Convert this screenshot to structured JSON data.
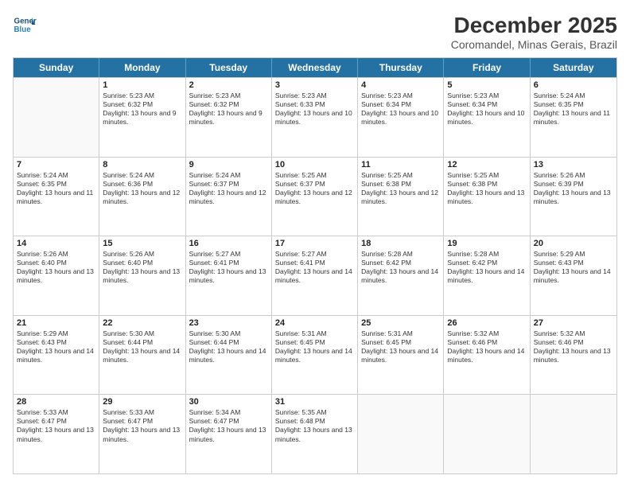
{
  "logo": {
    "line1": "General",
    "line2": "Blue"
  },
  "title": "December 2025",
  "subtitle": "Coromandel, Minas Gerais, Brazil",
  "header_days": [
    "Sunday",
    "Monday",
    "Tuesday",
    "Wednesday",
    "Thursday",
    "Friday",
    "Saturday"
  ],
  "weeks": [
    [
      {
        "day": "",
        "sunrise": "",
        "sunset": "",
        "daylight": ""
      },
      {
        "day": "1",
        "sunrise": "Sunrise: 5:23 AM",
        "sunset": "Sunset: 6:32 PM",
        "daylight": "Daylight: 13 hours and 9 minutes."
      },
      {
        "day": "2",
        "sunrise": "Sunrise: 5:23 AM",
        "sunset": "Sunset: 6:32 PM",
        "daylight": "Daylight: 13 hours and 9 minutes."
      },
      {
        "day": "3",
        "sunrise": "Sunrise: 5:23 AM",
        "sunset": "Sunset: 6:33 PM",
        "daylight": "Daylight: 13 hours and 10 minutes."
      },
      {
        "day": "4",
        "sunrise": "Sunrise: 5:23 AM",
        "sunset": "Sunset: 6:34 PM",
        "daylight": "Daylight: 13 hours and 10 minutes."
      },
      {
        "day": "5",
        "sunrise": "Sunrise: 5:23 AM",
        "sunset": "Sunset: 6:34 PM",
        "daylight": "Daylight: 13 hours and 10 minutes."
      },
      {
        "day": "6",
        "sunrise": "Sunrise: 5:24 AM",
        "sunset": "Sunset: 6:35 PM",
        "daylight": "Daylight: 13 hours and 11 minutes."
      }
    ],
    [
      {
        "day": "7",
        "sunrise": "Sunrise: 5:24 AM",
        "sunset": "Sunset: 6:35 PM",
        "daylight": "Daylight: 13 hours and 11 minutes."
      },
      {
        "day": "8",
        "sunrise": "Sunrise: 5:24 AM",
        "sunset": "Sunset: 6:36 PM",
        "daylight": "Daylight: 13 hours and 12 minutes."
      },
      {
        "day": "9",
        "sunrise": "Sunrise: 5:24 AM",
        "sunset": "Sunset: 6:37 PM",
        "daylight": "Daylight: 13 hours and 12 minutes."
      },
      {
        "day": "10",
        "sunrise": "Sunrise: 5:25 AM",
        "sunset": "Sunset: 6:37 PM",
        "daylight": "Daylight: 13 hours and 12 minutes."
      },
      {
        "day": "11",
        "sunrise": "Sunrise: 5:25 AM",
        "sunset": "Sunset: 6:38 PM",
        "daylight": "Daylight: 13 hours and 12 minutes."
      },
      {
        "day": "12",
        "sunrise": "Sunrise: 5:25 AM",
        "sunset": "Sunset: 6:38 PM",
        "daylight": "Daylight: 13 hours and 13 minutes."
      },
      {
        "day": "13",
        "sunrise": "Sunrise: 5:26 AM",
        "sunset": "Sunset: 6:39 PM",
        "daylight": "Daylight: 13 hours and 13 minutes."
      }
    ],
    [
      {
        "day": "14",
        "sunrise": "Sunrise: 5:26 AM",
        "sunset": "Sunset: 6:40 PM",
        "daylight": "Daylight: 13 hours and 13 minutes."
      },
      {
        "day": "15",
        "sunrise": "Sunrise: 5:26 AM",
        "sunset": "Sunset: 6:40 PM",
        "daylight": "Daylight: 13 hours and 13 minutes."
      },
      {
        "day": "16",
        "sunrise": "Sunrise: 5:27 AM",
        "sunset": "Sunset: 6:41 PM",
        "daylight": "Daylight: 13 hours and 13 minutes."
      },
      {
        "day": "17",
        "sunrise": "Sunrise: 5:27 AM",
        "sunset": "Sunset: 6:41 PM",
        "daylight": "Daylight: 13 hours and 14 minutes."
      },
      {
        "day": "18",
        "sunrise": "Sunrise: 5:28 AM",
        "sunset": "Sunset: 6:42 PM",
        "daylight": "Daylight: 13 hours and 14 minutes."
      },
      {
        "day": "19",
        "sunrise": "Sunrise: 5:28 AM",
        "sunset": "Sunset: 6:42 PM",
        "daylight": "Daylight: 13 hours and 14 minutes."
      },
      {
        "day": "20",
        "sunrise": "Sunrise: 5:29 AM",
        "sunset": "Sunset: 6:43 PM",
        "daylight": "Daylight: 13 hours and 14 minutes."
      }
    ],
    [
      {
        "day": "21",
        "sunrise": "Sunrise: 5:29 AM",
        "sunset": "Sunset: 6:43 PM",
        "daylight": "Daylight: 13 hours and 14 minutes."
      },
      {
        "day": "22",
        "sunrise": "Sunrise: 5:30 AM",
        "sunset": "Sunset: 6:44 PM",
        "daylight": "Daylight: 13 hours and 14 minutes."
      },
      {
        "day": "23",
        "sunrise": "Sunrise: 5:30 AM",
        "sunset": "Sunset: 6:44 PM",
        "daylight": "Daylight: 13 hours and 14 minutes."
      },
      {
        "day": "24",
        "sunrise": "Sunrise: 5:31 AM",
        "sunset": "Sunset: 6:45 PM",
        "daylight": "Daylight: 13 hours and 14 minutes."
      },
      {
        "day": "25",
        "sunrise": "Sunrise: 5:31 AM",
        "sunset": "Sunset: 6:45 PM",
        "daylight": "Daylight: 13 hours and 14 minutes."
      },
      {
        "day": "26",
        "sunrise": "Sunrise: 5:32 AM",
        "sunset": "Sunset: 6:46 PM",
        "daylight": "Daylight: 13 hours and 14 minutes."
      },
      {
        "day": "27",
        "sunrise": "Sunrise: 5:32 AM",
        "sunset": "Sunset: 6:46 PM",
        "daylight": "Daylight: 13 hours and 13 minutes."
      }
    ],
    [
      {
        "day": "28",
        "sunrise": "Sunrise: 5:33 AM",
        "sunset": "Sunset: 6:47 PM",
        "daylight": "Daylight: 13 hours and 13 minutes."
      },
      {
        "day": "29",
        "sunrise": "Sunrise: 5:33 AM",
        "sunset": "Sunset: 6:47 PM",
        "daylight": "Daylight: 13 hours and 13 minutes."
      },
      {
        "day": "30",
        "sunrise": "Sunrise: 5:34 AM",
        "sunset": "Sunset: 6:47 PM",
        "daylight": "Daylight: 13 hours and 13 minutes."
      },
      {
        "day": "31",
        "sunrise": "Sunrise: 5:35 AM",
        "sunset": "Sunset: 6:48 PM",
        "daylight": "Daylight: 13 hours and 13 minutes."
      },
      {
        "day": "",
        "sunrise": "",
        "sunset": "",
        "daylight": ""
      },
      {
        "day": "",
        "sunrise": "",
        "sunset": "",
        "daylight": ""
      },
      {
        "day": "",
        "sunrise": "",
        "sunset": "",
        "daylight": ""
      }
    ]
  ]
}
